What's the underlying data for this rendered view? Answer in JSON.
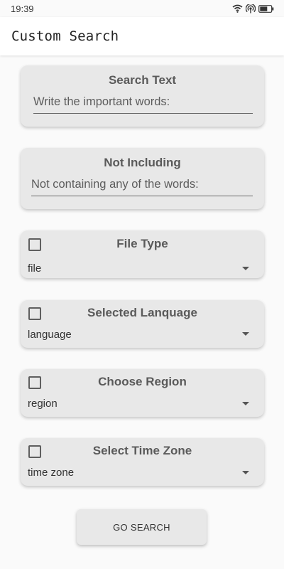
{
  "status_bar": {
    "time": "19:39"
  },
  "app_bar": {
    "title": "Custom Search"
  },
  "search_text": {
    "title": "Search Text",
    "placeholder": "Write the important words:"
  },
  "not_including": {
    "title": "Not Including",
    "placeholder": "Not containing any of the words:"
  },
  "file_type": {
    "title": "File Type",
    "value": "file",
    "checked": false
  },
  "language": {
    "title": "Selected Lanquage",
    "value": "language",
    "checked": false
  },
  "region": {
    "title": "Choose Region",
    "value": "region",
    "checked": false
  },
  "time_zone": {
    "title": "Select Time Zone",
    "value": "time zone",
    "checked": false
  },
  "go_button": {
    "label": "GO SEARCH"
  },
  "colors": {
    "card": "#e8e8e8",
    "background": "#fafafa",
    "app_bar": "#ffffff"
  },
  "icons": [
    "wifi-icon",
    "hotspot-icon",
    "battery-icon",
    "chevron-down-icon"
  ]
}
